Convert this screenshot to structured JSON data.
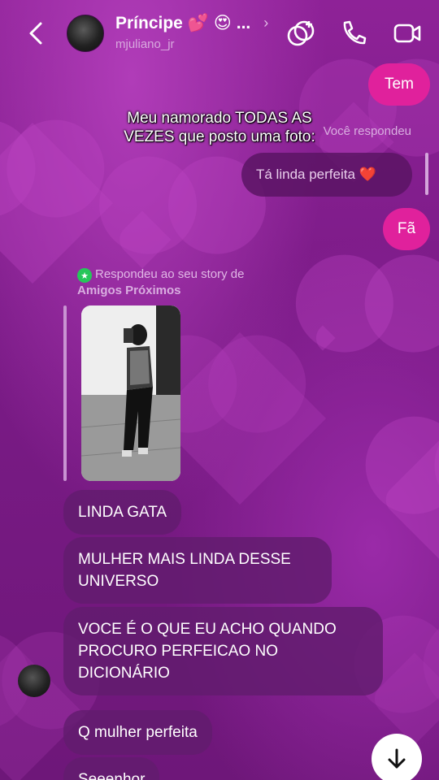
{
  "header": {
    "name": "Príncipe",
    "name_emojis": "💕 😍",
    "ellipsis": "...",
    "chevron": "›",
    "username": "mjuliano_jr",
    "icons": [
      "back-arrow-icon",
      "effects-icon",
      "phone-icon",
      "video-icon"
    ]
  },
  "overlay_caption": "Meu namorado TODAS AS VEZES que posto uma foto:",
  "messages_out": [
    {
      "text": "Tem"
    },
    {
      "text": "Fã"
    }
  ],
  "reply": {
    "label": "Você respondeu",
    "quoted_text": "Tá linda perfeita ❤️"
  },
  "story_reply": {
    "label_line1": "Respondeu ao seu story de",
    "label_line2": "Amigos Próximos",
    "badge_icon": "close-friends-star-icon"
  },
  "messages_in": [
    {
      "text": "LINDA GATA"
    },
    {
      "text": "MULHER MAIS LINDA DESSE UNIVERSO"
    },
    {
      "text": "VOCE É O QUE EU ACHO QUANDO PROCURO PERFEICAO NO DICIONÁRIO"
    },
    {
      "text": "Q mulher perfeita"
    },
    {
      "text": "Seeenhor"
    }
  ],
  "colors": {
    "accent_pink": "#e0219c",
    "background": "#7a1a86",
    "incoming_bubble": "#621c6e",
    "close_friends_green": "#27c65a"
  }
}
